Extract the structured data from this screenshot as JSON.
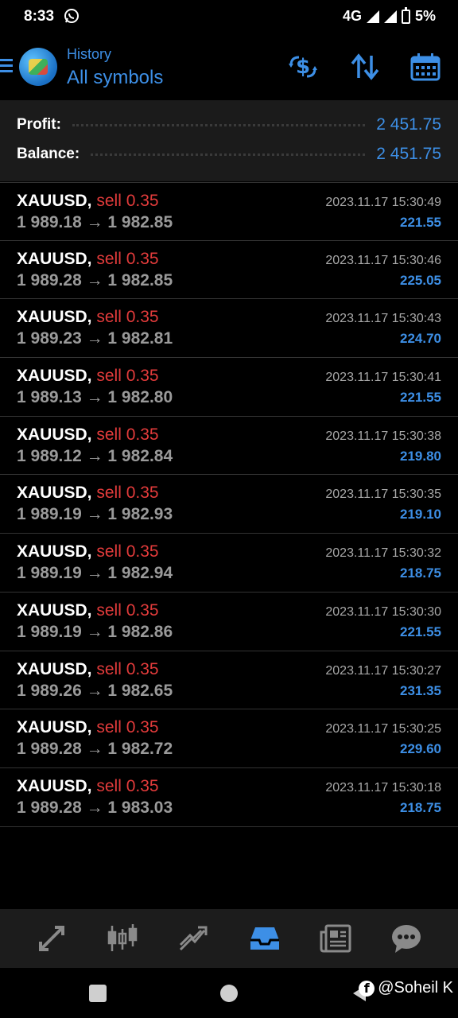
{
  "status_bar": {
    "time": "8:33",
    "network": "4G",
    "battery": "5%"
  },
  "header": {
    "subtitle": "History",
    "title": "All symbols",
    "icons": [
      "menu-icon",
      "app-logo",
      "money-exchange-icon",
      "sort-icon",
      "calendar-icon"
    ]
  },
  "summary": {
    "profit_label": "Profit:",
    "profit_value": "2 451.75",
    "balance_label": "Balance:",
    "balance_value": "2 451.75"
  },
  "deals": [
    {
      "symbol": "XAUUSD,",
      "side": "sell 0.35",
      "prices": "1 989.18 → 1 982.85",
      "time": "2023.11.17 15:30:49",
      "profit": "221.55"
    },
    {
      "symbol": "XAUUSD,",
      "side": "sell 0.35",
      "prices": "1 989.28 → 1 982.85",
      "time": "2023.11.17 15:30:46",
      "profit": "225.05"
    },
    {
      "symbol": "XAUUSD,",
      "side": "sell 0.35",
      "prices": "1 989.23 → 1 982.81",
      "time": "2023.11.17 15:30:43",
      "profit": "224.70"
    },
    {
      "symbol": "XAUUSD,",
      "side": "sell 0.35",
      "prices": "1 989.13 → 1 982.80",
      "time": "2023.11.17 15:30:41",
      "profit": "221.55"
    },
    {
      "symbol": "XAUUSD,",
      "side": "sell 0.35",
      "prices": "1 989.12 → 1 982.84",
      "time": "2023.11.17 15:30:38",
      "profit": "219.80"
    },
    {
      "symbol": "XAUUSD,",
      "side": "sell 0.35",
      "prices": "1 989.19 → 1 982.93",
      "time": "2023.11.17 15:30:35",
      "profit": "219.10"
    },
    {
      "symbol": "XAUUSD,",
      "side": "sell 0.35",
      "prices": "1 989.19 → 1 982.94",
      "time": "2023.11.17 15:30:32",
      "profit": "218.75"
    },
    {
      "symbol": "XAUUSD,",
      "side": "sell 0.35",
      "prices": "1 989.19 → 1 982.86",
      "time": "2023.11.17 15:30:30",
      "profit": "221.55"
    },
    {
      "symbol": "XAUUSD,",
      "side": "sell 0.35",
      "prices": "1 989.26 → 1 982.65",
      "time": "2023.11.17 15:30:27",
      "profit": "231.35"
    },
    {
      "symbol": "XAUUSD,",
      "side": "sell 0.35",
      "prices": "1 989.28 → 1 982.72",
      "time": "2023.11.17 15:30:25",
      "profit": "229.60"
    },
    {
      "symbol": "XAUUSD,",
      "side": "sell 0.35",
      "prices": "1 989.28 → 1 983.03",
      "time": "2023.11.17 15:30:18",
      "profit": "218.75"
    }
  ],
  "bottom_nav": {
    "items": [
      "quotes-icon",
      "chart-icon",
      "trade-icon",
      "history-icon",
      "news-icon",
      "chat-icon"
    ],
    "active": "history-icon"
  },
  "watermark": {
    "text": "@Soheil K"
  },
  "colors": {
    "accent": "#3d8fe6",
    "sell": "#e23b3b",
    "background": "#000000",
    "panel": "#1b1b1b"
  }
}
